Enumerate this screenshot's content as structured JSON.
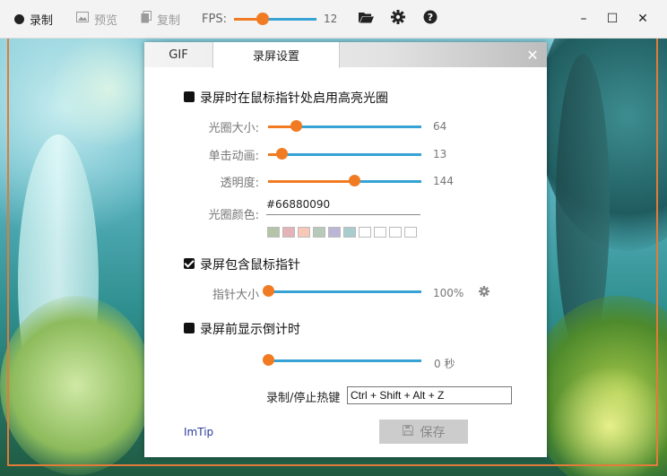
{
  "toolbar": {
    "record_label": "录制",
    "preview_label": "预览",
    "copy_label": "复制",
    "fps_label": "FPS:",
    "fps_value": "12",
    "fps_fraction": 0.35,
    "icons": [
      "folder-open-icon",
      "gear-icon",
      "help-icon"
    ]
  },
  "window": {
    "minimize": "–",
    "maximize": "☐",
    "close": "✕"
  },
  "dialog": {
    "tabs": [
      {
        "label": "GIF"
      },
      {
        "label": "录屏设置"
      }
    ],
    "close": "✕",
    "highlight": {
      "title": "录屏时在鼠标指针处启用高亮光圈",
      "checked": false,
      "size_label": "光圈大小:",
      "size_value": "64",
      "size_fraction": 0.18,
      "click_label": "单击动画:",
      "click_value": "13",
      "click_fraction": 0.09,
      "opacity_label": "透明度:",
      "opacity_value": "144",
      "opacity_fraction": 0.56,
      "color_label": "光圈颜色:",
      "color_value": "#66880090",
      "swatches": [
        "#b5c4a7",
        "#e3b3b8",
        "#f7c7b7",
        "#b7c9b9",
        "#bcb6d6",
        "#a9cccc",
        "#ffffff",
        "#ffffff",
        "#ffffff",
        "#ffffff"
      ]
    },
    "cursor": {
      "title": "录屏包含鼠标指针",
      "checked": true,
      "size_label": "指针大小",
      "size_value": "100%",
      "size_fraction": 0.0
    },
    "countdown": {
      "title": "录屏前显示倒计时",
      "checked": false,
      "value": "0 秒",
      "fraction": 0.0
    },
    "hotkey": {
      "label": "录制/停止热键",
      "value": "Ctrl + Shift + Alt + Z"
    },
    "imtip": "ImTip",
    "save_label": "保存"
  },
  "colors": {
    "accent_orange": "#f07b22",
    "accent_blue": "#36a3d4",
    "frame_orange": "#e07b39"
  }
}
